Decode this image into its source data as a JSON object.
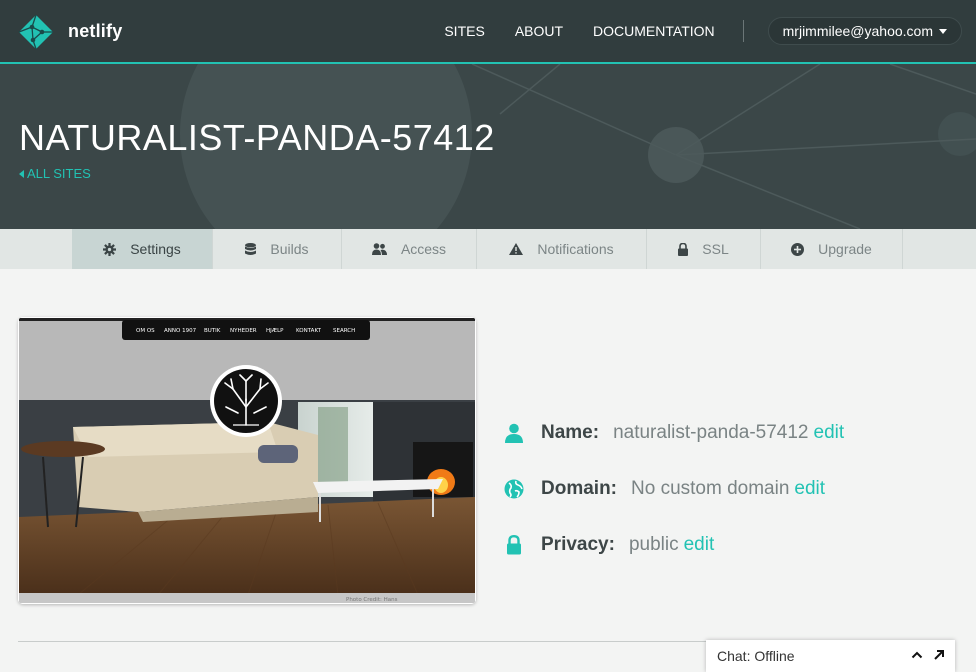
{
  "nav": {
    "brand": "netlify",
    "links": [
      "SITES",
      "ABOUT",
      "DOCUMENTATION"
    ],
    "user": "mrjimmilee@yahoo.com"
  },
  "hero": {
    "title": "NATURALIST-PANDA-57412",
    "back_link": "ALL SITES"
  },
  "tabs": [
    {
      "label": "Settings",
      "icon": "gear-icon",
      "active": true
    },
    {
      "label": "Builds",
      "icon": "database-icon"
    },
    {
      "label": "Access",
      "icon": "users-icon"
    },
    {
      "label": "Notifications",
      "icon": "warning-icon"
    },
    {
      "label": "SSL",
      "icon": "lock-icon"
    },
    {
      "label": "Upgrade",
      "icon": "plus-circle-icon"
    }
  ],
  "preview": {
    "menu": [
      "OM OS",
      "ANNO 1907",
      "BUTIK",
      "NYHEDER",
      "HJÆLP",
      "KONTAKT",
      "SEARCH"
    ],
    "credit": "Photo Credit: Hans"
  },
  "site_info": {
    "name": {
      "label": "Name:",
      "value": "naturalist-panda-57412",
      "edit": "edit"
    },
    "domain": {
      "label": "Domain:",
      "value": "No custom domain",
      "edit": "edit"
    },
    "privacy": {
      "label": "Privacy:",
      "value": "public",
      "edit": "edit"
    }
  },
  "chat": {
    "status": "Chat: Offline"
  },
  "colors": {
    "accent": "#22c2b3",
    "nav_bg": "#313d3e",
    "hero_bg": "#3b4748",
    "tab_bar": "#e1e6e4",
    "page_bg": "#f3f4f3"
  }
}
